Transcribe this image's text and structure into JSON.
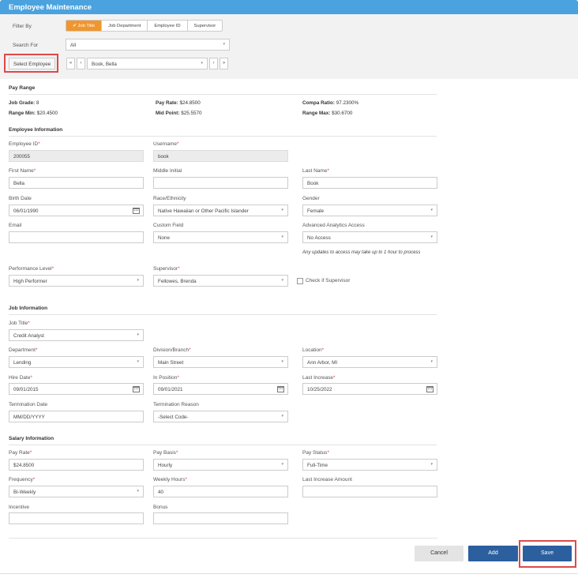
{
  "title": "Employee Maintenance",
  "filter": {
    "filter_by_label": "Filter By",
    "options": [
      "Job Title",
      "Job Department",
      "Employee ID",
      "Supervisor"
    ],
    "selected_icon": "check-icon",
    "search_for_label": "Search For",
    "search_for_value": "All",
    "select_employee_label": "Select Employee",
    "employee_value": "Book, Bella",
    "nav_first": "«",
    "nav_prev": "‹",
    "nav_next": "›",
    "nav_last": "»"
  },
  "pay_range": {
    "heading": "Pay Range",
    "job_grade_label": "Job Grade:",
    "job_grade": "8",
    "pay_rate_label": "Pay Rate:",
    "pay_rate": "$24.8500",
    "compa_ratio_label": "Compa Ratio:",
    "compa_ratio": "97.2300%",
    "range_min_label": "Range Min:",
    "range_min": "$20.4500",
    "mid_point_label": "Mid Point:",
    "mid_point": "$25.5570",
    "range_max_label": "Range Max:",
    "range_max": "$30.6700"
  },
  "employee_info": {
    "heading": "Employee Information",
    "employee_id_label": "Employee ID",
    "employee_id": "200055",
    "username_label": "Username",
    "username": "book",
    "first_name_label": "First Name",
    "first_name": "Bella",
    "middle_initial_label": "Middle Initial",
    "middle_initial": "",
    "last_name_label": "Last Name",
    "last_name": "Book",
    "birth_date_label": "Birth Date",
    "birth_date": "06/01/1990",
    "race_label": "Race/Ethnicity",
    "race": "Native Hawaiian or Other Pacific Islander",
    "gender_label": "Gender",
    "gender": "Female",
    "email_label": "Email",
    "email": "",
    "custom_field_label": "Custom Field",
    "custom_field": "None",
    "analytics_label": "Advanced Analytics Access",
    "analytics": "No Access",
    "analytics_note": "Any updates to access may take up to 1 hour to process",
    "performance_label": "Performance Level",
    "performance": "High Performer",
    "supervisor_label": "Supervisor",
    "supervisor": "Fellowes, Brenda",
    "check_supervisor_label": "Check if Supervisor"
  },
  "job_info": {
    "heading": "Job Information",
    "job_title_label": "Job Title",
    "job_title": "Credit Analyst",
    "department_label": "Department",
    "department": "Lending",
    "division_label": "Division/Branch",
    "division": "Main Street",
    "location_label": "Location",
    "location": "Ann Arbor, MI",
    "hire_date_label": "Hire Date",
    "hire_date": "09/01/2015",
    "in_position_label": "In Position",
    "in_position": "09/01/2021",
    "last_increase_label": "Last Increase",
    "last_increase": "10/25/2022",
    "termination_date_label": "Termination Date",
    "termination_date_placeholder": "MM/DD/YYYY",
    "termination_reason_label": "Termination Reason",
    "termination_reason": "-Select Code-"
  },
  "salary_info": {
    "heading": "Salary Information",
    "pay_rate_label": "Pay Rate",
    "pay_rate": "$24.8500",
    "pay_basis_label": "Pay Basis",
    "pay_basis": "Hourly",
    "pay_status_label": "Pay Status",
    "pay_status": "Full-Time",
    "frequency_label": "Frequency",
    "frequency": "Bi-Weekly",
    "weekly_hours_label": "Weekly Hours",
    "weekly_hours": "40",
    "last_increase_amount_label": "Last Increase Amount",
    "last_increase_amount": "",
    "incentive_label": "Incentive",
    "incentive": "",
    "bonus_label": "Bonus",
    "bonus": ""
  },
  "required_mark": "*",
  "dropdown_glyph": "▾",
  "buttons": {
    "cancel": "Cancel",
    "add": "Add",
    "save": "Save"
  },
  "colors": {
    "header": "#4aa3de",
    "accent": "#f0962e",
    "primary_button": "#2c5f9e",
    "highlight": "#e04848"
  }
}
